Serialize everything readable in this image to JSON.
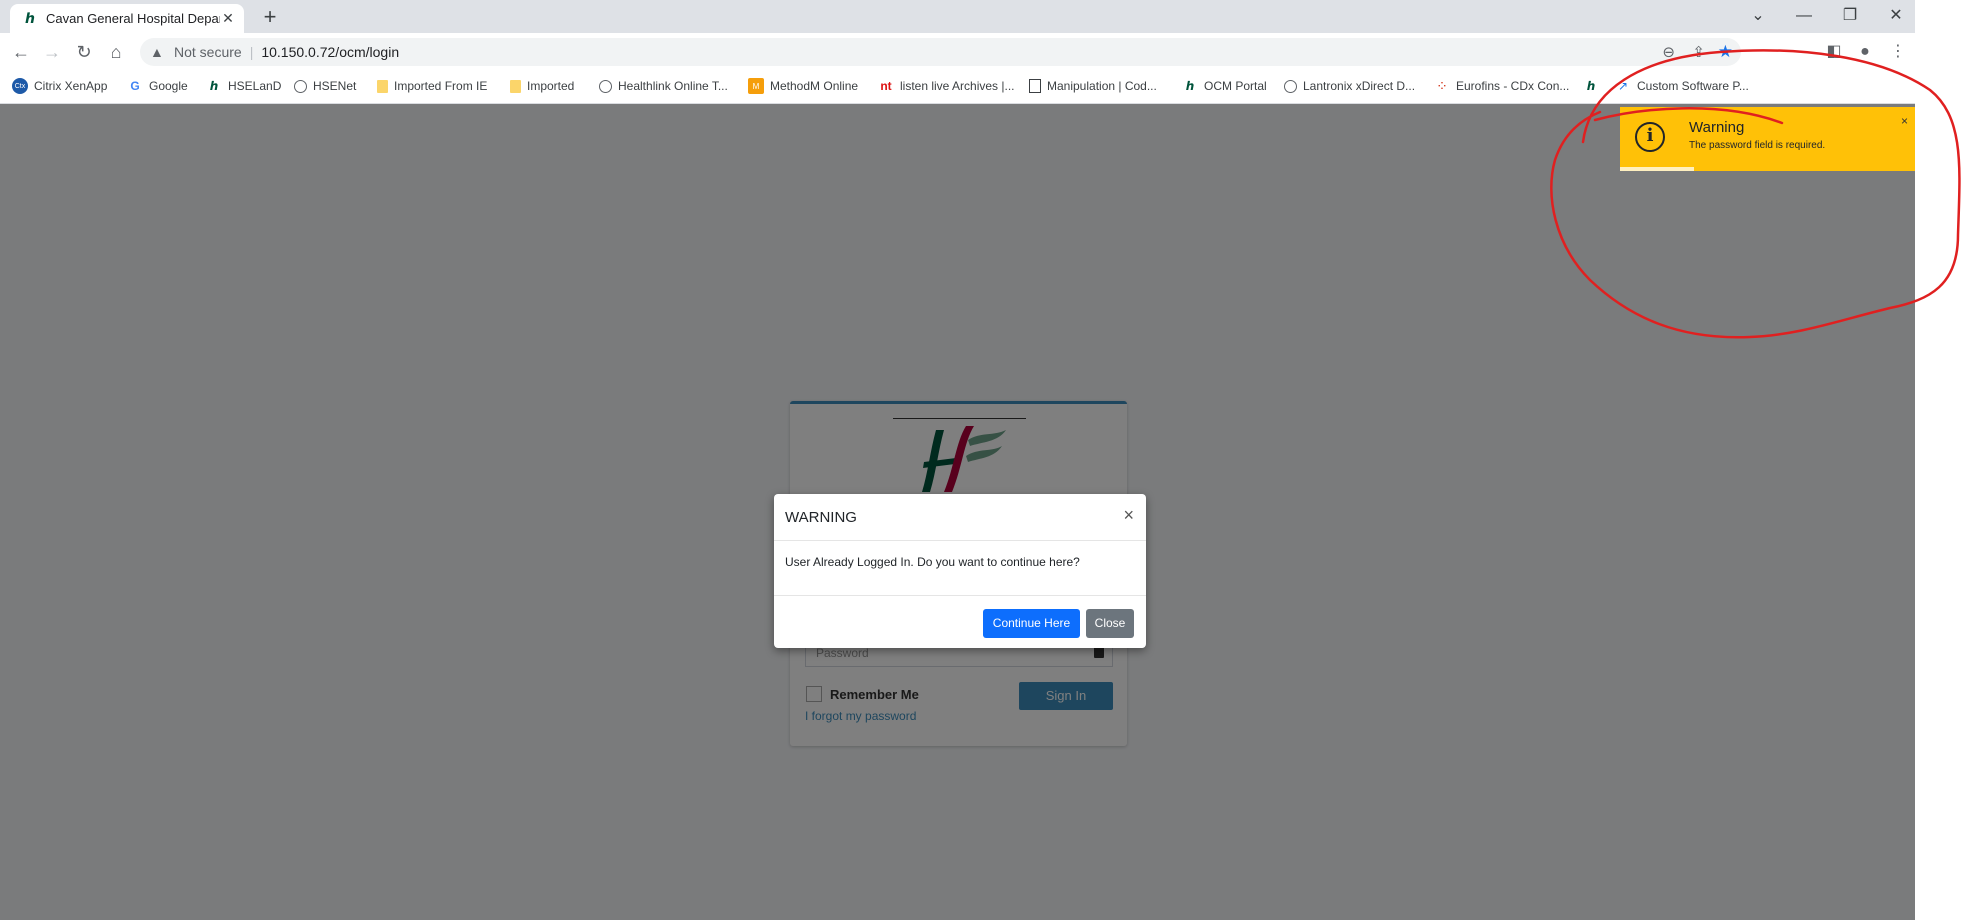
{
  "browser": {
    "tab_title": "Cavan General Hospital Departm",
    "tab_favicon": "hse-logo-icon",
    "new_tab": "+",
    "security_label": "Not secure",
    "url": "10.150.0.72/ocm/login",
    "window_controls": [
      "minimize",
      "restore",
      "close"
    ]
  },
  "bookmarks": [
    {
      "label": "Citrix XenApp",
      "icon": "citrix-icon"
    },
    {
      "label": "Google",
      "icon": "google-icon"
    },
    {
      "label": "HSELanD",
      "icon": "hse-icon"
    },
    {
      "label": "HSENet",
      "icon": "globe-icon"
    },
    {
      "label": "Imported From IE",
      "icon": "folder-icon"
    },
    {
      "label": "Imported",
      "icon": "folder-icon"
    },
    {
      "label": "Healthlink Online T...",
      "icon": "globe-icon"
    },
    {
      "label": "MethodM Online",
      "icon": "methodm-icon"
    },
    {
      "label": "listen live Archives |...",
      "icon": "nt-icon"
    },
    {
      "label": "Manipulation | Cod...",
      "icon": "doc-icon"
    },
    {
      "label": "OCM Portal",
      "icon": "hse-icon"
    },
    {
      "label": "Lantronix xDirect D...",
      "icon": "globe-icon"
    },
    {
      "label": "Eurofins - CDx Con...",
      "icon": "eurofins-icon"
    },
    {
      "label": "",
      "icon": "hse-icon"
    },
    {
      "label": "Custom Software P...",
      "icon": "arrow-icon"
    }
  ],
  "login": {
    "password_placeholder": "Password",
    "remember_label": "Remember Me",
    "signin_label": "Sign In",
    "forgot_label": "I forgot my password",
    "accent": "#3c8dbc"
  },
  "modal": {
    "title": "WARNING",
    "close_glyph": "×",
    "message": "User Already Logged In. Do you want to continue here?",
    "continue_label": "Continue Here",
    "close_label": "Close"
  },
  "toast": {
    "title": "Warning",
    "message": "The password field is required.",
    "close_glyph": "×",
    "icon": "info-icon",
    "color": "#ffc107",
    "progress": 0.25
  },
  "annotation_color": "#e02020"
}
